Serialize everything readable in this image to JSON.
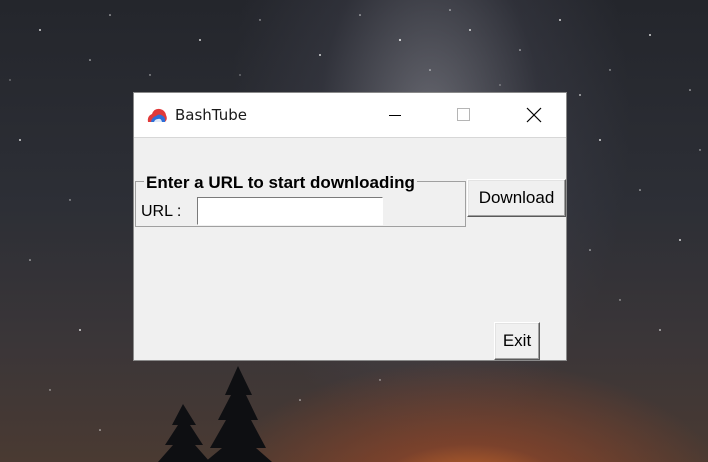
{
  "window": {
    "title": "BashTube",
    "app_icon": "bashtube-logo-icon",
    "controls": {
      "minimize_icon": "minimize-icon",
      "maximize_icon": "maximize-icon",
      "close_icon": "close-icon"
    }
  },
  "form": {
    "group_title": "Enter a URL to start downloading",
    "url_label": "URL :",
    "url_value": "",
    "download_label": "Download",
    "exit_label": "Exit"
  },
  "colors": {
    "window_bg": "#f0f0f0",
    "titlebar_bg": "#ffffff",
    "logo_red": "#e03a3a",
    "logo_blue": "#2d6fd8"
  }
}
